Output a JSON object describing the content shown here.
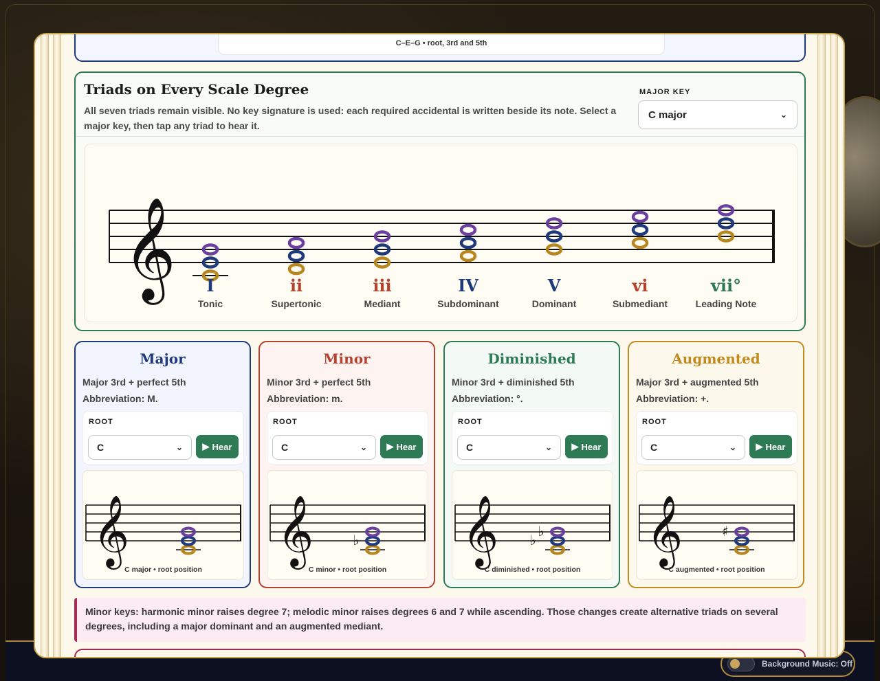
{
  "prev": {
    "caption": "C–E–G • root, 3rd and 5th"
  },
  "triads": {
    "title": "Triads on Every Scale Degree",
    "description": "All seven triads remain visible. No key signature is used: each required accidental is written beside its note. Select a major key, then tap any triad to hear it.",
    "key_label": "MAJOR KEY",
    "key_value": "C major",
    "degrees": [
      {
        "numeral": "I",
        "name": "Tonic",
        "color": "#1f3a7a"
      },
      {
        "numeral": "ii",
        "name": "Supertonic",
        "color": "#b5412f"
      },
      {
        "numeral": "iii",
        "name": "Mediant",
        "color": "#b5412f"
      },
      {
        "numeral": "IV",
        "name": "Subdominant",
        "color": "#1f3a7a"
      },
      {
        "numeral": "V",
        "name": "Dominant",
        "color": "#1f3a7a"
      },
      {
        "numeral": "vi",
        "name": "Submediant",
        "color": "#b5412f"
      },
      {
        "numeral": "vii°",
        "name": "Leading Note",
        "color": "#2e7a55"
      }
    ]
  },
  "types": [
    {
      "title": "Major",
      "desc1": "Major 3rd + perfect 5th",
      "desc2": "Abbreviation: M.",
      "root_label": "ROOT",
      "root_value": "C",
      "hear": "Hear",
      "caption": "C major • root position",
      "color": "#1f3a7a",
      "bg": "#f2f5fd"
    },
    {
      "title": "Minor",
      "desc1": "Minor 3rd + perfect 5th",
      "desc2": "Abbreviation: m.",
      "root_label": "ROOT",
      "root_value": "C",
      "hear": "Hear",
      "caption": "C minor • root position",
      "color": "#b5412f",
      "bg": "#fdf4f1"
    },
    {
      "title": "Diminished",
      "desc1": "Minor 3rd + diminished 5th",
      "desc2": "Abbreviation: °.",
      "root_label": "ROOT",
      "root_value": "C",
      "hear": "Hear",
      "caption": "C diminished • root position",
      "color": "#2e7a55",
      "bg": "#f3faf6"
    },
    {
      "title": "Augmented",
      "desc1": "Major 3rd + augmented 5th",
      "desc2": "Abbreviation: +.",
      "root_label": "ROOT",
      "root_value": "C",
      "hear": "Hear",
      "caption": "C augmented • root position",
      "color": "#c28a1e",
      "bg": "#fdf8ec"
    }
  ],
  "note": "Minor keys: harmonic minor raises degree 7; melodic minor raises degrees 6 and 7 while ascending. Those changes create alternative triads on several degrees, including a major dominant and an augmented mediant.",
  "music": {
    "label": "Background Music: Off"
  },
  "colors": {
    "root": "#b8861f",
    "third": "#1f3a7a",
    "fifth": "#6a3fa0"
  }
}
